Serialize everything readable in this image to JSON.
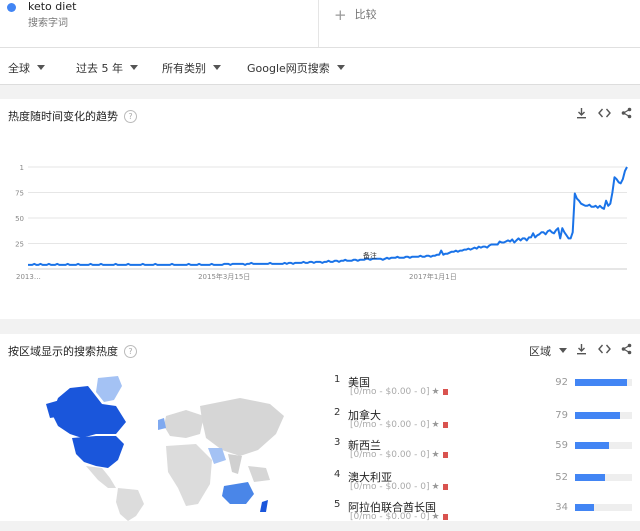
{
  "search_term": {
    "name": "keto diet",
    "subtitle": "搜索字词",
    "dot_color": "#4285f4"
  },
  "compare": {
    "label": "比较"
  },
  "filters": {
    "region": "全球",
    "time": "过去 5 年",
    "category": "所有类别",
    "search_type": "Google网页搜索"
  },
  "trend": {
    "title": "热度随时间变化的趋势",
    "help": "?",
    "annotation": "备注",
    "icons": [
      "download-icon",
      "embed-icon",
      "share-icon"
    ]
  },
  "chart_data": {
    "type": "line",
    "title": "",
    "xlabel": "",
    "ylabel": "",
    "ylim": [
      0,
      100
    ],
    "yticks": [
      {
        "value": 100,
        "label": "1"
      },
      {
        "value": 75,
        "label": "75"
      },
      {
        "value": 50,
        "label": "50"
      },
      {
        "value": 25,
        "label": "25"
      }
    ],
    "xticks": [
      {
        "index": 0,
        "label": "2013…"
      },
      {
        "index": 94,
        "label": "2015年3月15日"
      },
      {
        "index": 194,
        "label": "2017年1月1日"
      }
    ],
    "series": [
      {
        "color": "#1a73e8",
        "values": [
          4,
          4,
          4,
          5,
          4,
          4,
          5,
          4,
          4,
          4,
          5,
          4,
          4,
          4,
          5,
          4,
          4,
          4,
          4,
          5,
          4,
          4,
          4,
          4,
          5,
          4,
          4,
          4,
          4,
          4,
          5,
          4,
          4,
          4,
          4,
          5,
          4,
          4,
          4,
          4,
          4,
          4,
          5,
          4,
          4,
          4,
          4,
          4,
          5,
          4,
          4,
          4,
          4,
          4,
          4,
          5,
          4,
          4,
          4,
          4,
          4,
          5,
          4,
          4,
          4,
          4,
          4,
          4,
          4,
          5,
          4,
          4,
          4,
          4,
          4,
          4,
          4,
          5,
          4,
          4,
          4,
          4,
          5,
          4,
          4,
          4,
          4,
          4,
          5,
          4,
          4,
          4,
          4,
          4,
          5,
          5,
          5,
          4,
          5,
          5,
          5,
          5,
          5,
          5,
          4,
          5,
          5,
          6,
          5,
          5,
          5,
          5,
          5,
          5,
          5,
          5,
          6,
          5,
          5,
          5,
          5,
          5,
          5,
          6,
          5,
          6,
          6,
          5,
          6,
          6,
          6,
          6,
          7,
          6,
          6,
          7,
          7,
          6,
          7,
          7,
          7,
          6,
          7,
          7,
          8,
          7,
          7,
          8,
          8,
          7,
          8,
          8,
          9,
          8,
          8,
          8,
          9,
          9,
          8,
          9,
          9,
          9,
          10,
          10,
          9,
          10,
          10,
          10,
          10,
          10,
          9,
          10,
          11,
          10,
          11,
          11,
          11,
          12,
          11,
          11,
          11,
          12,
          12,
          11,
          12,
          12,
          12,
          12,
          13,
          12,
          12,
          13,
          13,
          12,
          13,
          13,
          14,
          14,
          18,
          14,
          15,
          15,
          16,
          17,
          17,
          18,
          17,
          18,
          18,
          19,
          19,
          20,
          19,
          20,
          21,
          20,
          22,
          21,
          22,
          22,
          21,
          23,
          24,
          24,
          24,
          24,
          27,
          26,
          26,
          27,
          28,
          27,
          29,
          26,
          28,
          30,
          28,
          30,
          30,
          28,
          31,
          31,
          35,
          31,
          33,
          34,
          36,
          36,
          34,
          37,
          38,
          36,
          35,
          38,
          40,
          30,
          40,
          36,
          33,
          30,
          30,
          36,
          74,
          69,
          67,
          64,
          63,
          62,
          62,
          63,
          61,
          61,
          62,
          60,
          62,
          60,
          59,
          67,
          62,
          64,
          75,
          90,
          88,
          85,
          84,
          88,
          96,
          100
        ]
      }
    ]
  },
  "regions": {
    "title": "按区域显示的搜索热度",
    "help": "?",
    "level_label": "区域",
    "meta_text": "[0/mo - $0.00 - 0]",
    "items": [
      {
        "rank": "1",
        "name": "美国",
        "value": 92
      },
      {
        "rank": "2",
        "name": "加拿大",
        "value": 79
      },
      {
        "rank": "3",
        "name": "新西兰",
        "value": 59
      },
      {
        "rank": "4",
        "name": "澳大利亚",
        "value": 52
      },
      {
        "rank": "5",
        "name": "阿拉伯联合酋长国",
        "value": 34
      }
    ],
    "bar_color": "#4285f4"
  }
}
